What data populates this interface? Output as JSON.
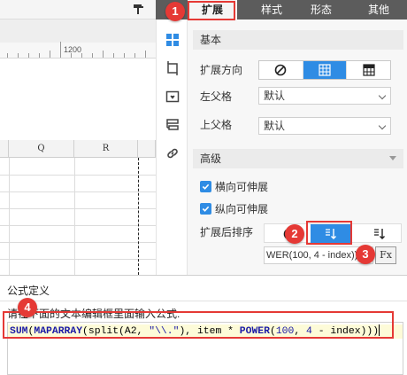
{
  "tabs": [
    {
      "label": "扩展",
      "active": true
    },
    {
      "label": "样式",
      "active": false
    },
    {
      "label": "形态",
      "active": false
    },
    {
      "label": "其他",
      "active": false
    }
  ],
  "ruler": {
    "mark": "1200"
  },
  "grid": {
    "columns": [
      "Q",
      "R"
    ]
  },
  "panel": {
    "basic_section": "基本",
    "expand_direction_label": "扩展方向",
    "left_parent_label": "左父格",
    "left_parent_value": "默认",
    "top_parent_label": "上父格",
    "top_parent_value": "默认",
    "advanced_section": "高级",
    "horizontal_expandable": "横向可伸展",
    "vertical_expandable": "纵向可伸展",
    "sort_label": "扩展后排序",
    "formula_field_value": "WER(100, 4 - index)))",
    "fx_button": "Fx"
  },
  "dialog": {
    "title": "公式定义",
    "hint": "请在下面的文本编辑框里面输入公式:",
    "formula": "SUM(MAPARRAY(split(A2, \"\\\\.\"), item * POWER(100, 4 - index)))"
  },
  "markers": [
    "1",
    "2",
    "3",
    "4"
  ],
  "colors": {
    "accent": "#2f8ce4",
    "highlight": "#e53935",
    "tabbar": "#5c5c5c"
  }
}
